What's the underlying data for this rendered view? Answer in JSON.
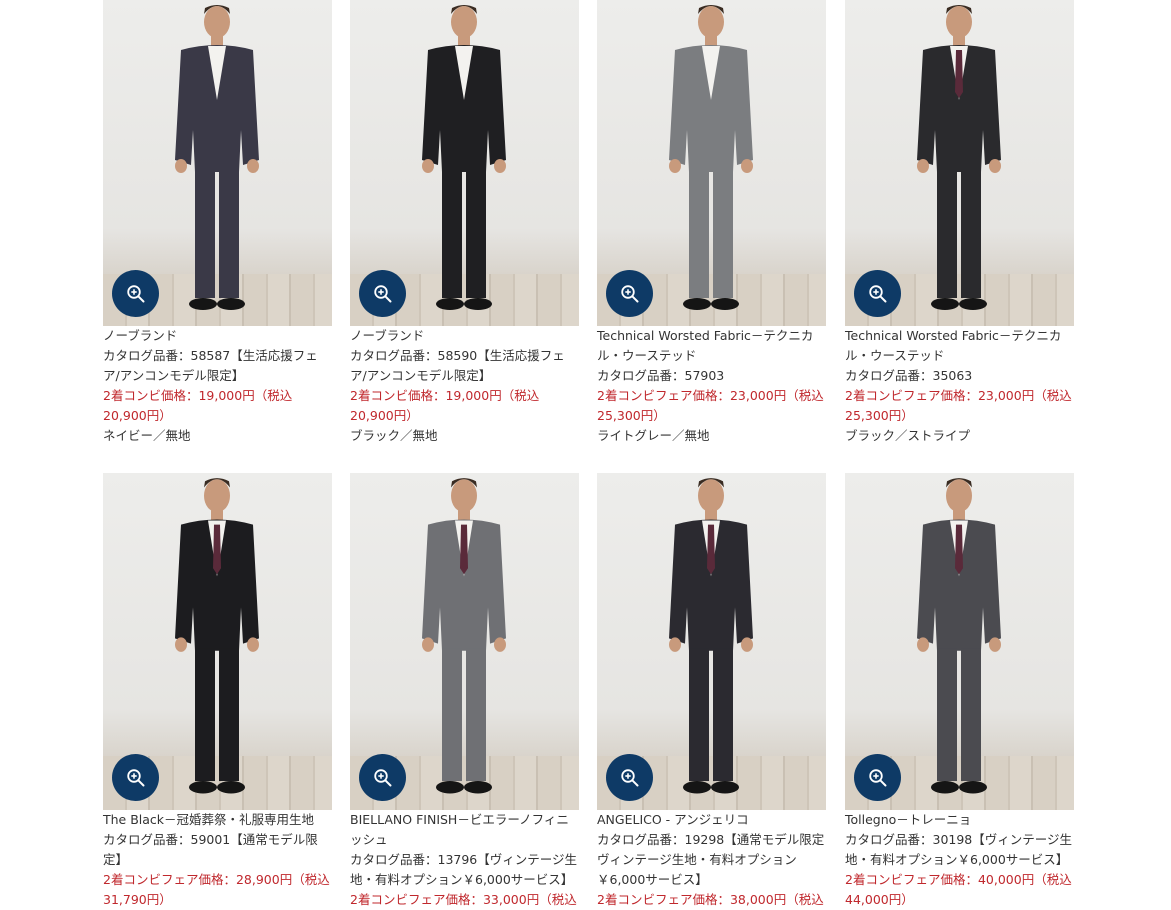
{
  "products": [
    {
      "name": "ノーブランド",
      "catalog": "カタログ品番：58587【生活応援フェア/アンコンモデル限定】",
      "price": "2着コンビ価格：19,000円（税込 20,900円）",
      "color": "ネイビー／無地",
      "suit_color": "#3a3947",
      "tie": false
    },
    {
      "name": "ノーブランド",
      "catalog": "カタログ品番：58590【生活応援フェア/アンコンモデル限定】",
      "price": "2着コンビ価格：19,000円（税込 20,900円）",
      "color": "ブラック／無地",
      "suit_color": "#1f1f22",
      "tie": false
    },
    {
      "name": "Technical Worsted Fabric－テクニカル・ウーステッド",
      "catalog": "カタログ品番：57903",
      "price": "2着コンビフェア価格：23,000円（税込25,300円）",
      "color": "ライトグレー／無地",
      "suit_color": "#7b7d80",
      "tie": false
    },
    {
      "name": "Technical Worsted Fabric－テクニカル・ウーステッド",
      "catalog": "カタログ品番：35063",
      "price": "2着コンビフェア価格：23,000円（税込25,300円）",
      "color": "ブラック／ストライプ",
      "suit_color": "#2a2a2d",
      "tie": true
    },
    {
      "name": "The Black－冠婚葬祭・礼服専用生地",
      "catalog": "カタログ品番：59001【通常モデル限定】",
      "price": "2着コンビフェア価格：28,900円（税込31,790円）",
      "color": "",
      "suit_color": "#1c1c1f",
      "tie": true
    },
    {
      "name": "BIELLANO FINISH－ビエラーノフィニッシュ",
      "catalog": "カタログ品番：13796【ヴィンテージ生地・有料オプション￥6,000サービス】",
      "price": "2着コンビフェア価格：33,000円（税込",
      "color": "",
      "suit_color": "#6f7074",
      "tie": true
    },
    {
      "name": "ANGELICO - アンジェリコ",
      "catalog": "カタログ品番：19298【通常モデル限定ヴィンテージ生地・有料オプション￥6,000サービス】",
      "price": "2着コンビフェア価格：38,000円（税込",
      "color": "",
      "suit_color": "#2b2a30",
      "tie": true
    },
    {
      "name": "Tollegno－トレーニョ",
      "catalog": "カタログ品番：30198【ヴィンテージ生地・有料オプション￥6,000サービス】",
      "price": "2着コンビフェア価格：40,000円（税込44,000円）",
      "color": "",
      "suit_color": "#4b4b50",
      "tie": true
    }
  ],
  "icons": {
    "zoom": "zoom-in-icon"
  },
  "colors": {
    "accent": "#0e3a66",
    "price": "#c0282d"
  }
}
